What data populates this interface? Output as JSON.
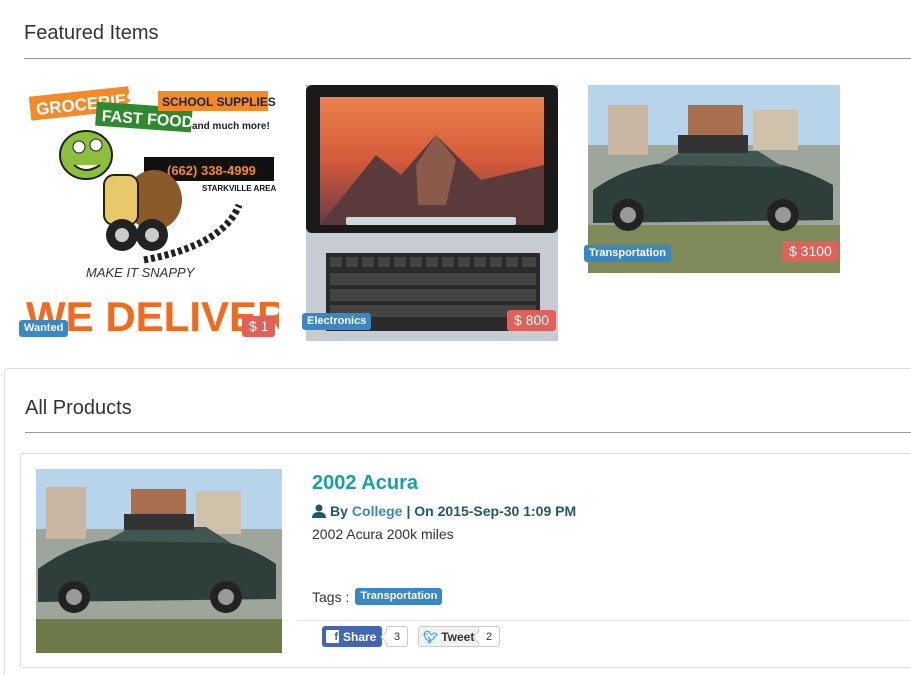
{
  "featured": {
    "title": "Featured Items",
    "items": [
      {
        "category": "Wanted",
        "price": "$ 1",
        "ad": {
          "line1": "GROCERIES",
          "line2": "FAST FOOD",
          "line3": "SCHOOL SUPPLIES",
          "line4": "and much more!",
          "phone": "(662) 338-4999",
          "area": "STARKVILLE AREA",
          "brand": "MAKE IT SNAPPY",
          "slogan": "WE DELIVER!"
        }
      },
      {
        "category": "Electronics",
        "price": "$ 800"
      },
      {
        "category": "Transportation",
        "price": "$ 3100"
      }
    ]
  },
  "all_products": {
    "title": "All Products",
    "product": {
      "name": "2002 Acura",
      "by_prefix": "By",
      "author": "College",
      "date": "| On 2015-Sep-30 1:09 PM",
      "description": "2002 Acura 200k miles",
      "tags_label": "Tags :",
      "tag": "Transportation",
      "share_label": "Share",
      "share_count": "3",
      "tweet_label": "Tweet",
      "tweet_count": "2"
    }
  },
  "colors": {
    "label_blue": "#3a87c8",
    "price_red": "#e0605a",
    "title_teal": "#17a2a0"
  }
}
